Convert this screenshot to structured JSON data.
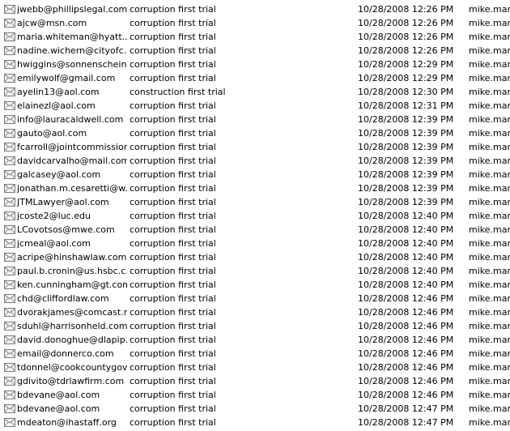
{
  "rows": [
    {
      "from": "jwebb@phillipslegal.com",
      "subject": "corruption first trial",
      "date": "10/28/2008 12:26 PM",
      "user": "mike.mars"
    },
    {
      "from": "ajcw@msn.com",
      "subject": "corruption first trial",
      "date": "10/28/2008 12:26 PM",
      "user": "mike.mars"
    },
    {
      "from": "maria.whiteman@hyatt....",
      "subject": "corruption first trial",
      "date": "10/28/2008 12:26 PM",
      "user": "mike.mars"
    },
    {
      "from": "nadine.wichern@cityofc...",
      "subject": "corruption first trial",
      "date": "10/28/2008 12:26 PM",
      "user": "mike.mars"
    },
    {
      "from": "hwiggins@sonnenschein....",
      "subject": "corruption first trial",
      "date": "10/28/2008 12:29 PM",
      "user": "mike.mars"
    },
    {
      "from": "emilywolf@gmail.com",
      "subject": "corruption first trial",
      "date": "10/28/2008 12:29 PM",
      "user": "mike.mars"
    },
    {
      "from": "ayelin13@aol.com",
      "subject": "construction first trial",
      "date": "10/28/2008 12:30 PM",
      "user": "mike.mars"
    },
    {
      "from": "elainezl@aol.com",
      "subject": "corruption first trial",
      "date": "10/28/2008 12:31 PM",
      "user": "mike.mars"
    },
    {
      "from": "info@lauracaldwell.com",
      "subject": "corruption first trial",
      "date": "10/28/2008 12:39 PM",
      "user": "mike.mars"
    },
    {
      "from": "gauto@aol.com",
      "subject": "corruption first trial",
      "date": "10/28/2008 12:39 PM",
      "user": "mike.mars"
    },
    {
      "from": "fcarroll@jointcommission....",
      "subject": "corruption first trial",
      "date": "10/28/2008 12:39 PM",
      "user": "mike.mars"
    },
    {
      "from": "davidcarvalho@mail.com",
      "subject": "corruption first trial",
      "date": "10/28/2008 12:39 PM",
      "user": "mike.mars"
    },
    {
      "from": "galcasey@aol.com",
      "subject": "corruption first trial",
      "date": "10/28/2008 12:39 PM",
      "user": "mike.mars"
    },
    {
      "from": "jonathan.m.cesaretti@w...",
      "subject": "corruption first trial",
      "date": "10/28/2008 12:39 PM",
      "user": "mike.mars"
    },
    {
      "from": "JTMLawyer@aol.com",
      "subject": "corruption first trial",
      "date": "10/28/2008 12:39 PM",
      "user": "mike.mars"
    },
    {
      "from": "jcoste2@luc.edu",
      "subject": "corruption first trial",
      "date": "10/28/2008 12:40 PM",
      "user": "mike.mars"
    },
    {
      "from": "LCovotsos@mwe.com",
      "subject": "corruption first trial",
      "date": "10/28/2008 12:40 PM",
      "user": "mike.mars"
    },
    {
      "from": "jcmeal@aol.com",
      "subject": "corruption first trial",
      "date": "10/28/2008 12:40 PM",
      "user": "mike.mars"
    },
    {
      "from": "acripe@hinshawlaw.com",
      "subject": "corruption first trial",
      "date": "10/28/2008 12:40 PM",
      "user": "mike.mars"
    },
    {
      "from": "paul.b.cronin@us.hsbc.c...",
      "subject": "corruption first trial",
      "date": "10/28/2008 12:40 PM",
      "user": "mike.mars"
    },
    {
      "from": "ken.cunningham@gt.com",
      "subject": "corruption first trial",
      "date": "10/28/2008 12:40 PM",
      "user": "mike.mars"
    },
    {
      "from": "chd@cliffordlaw.com",
      "subject": "corruption first trial",
      "date": "10/28/2008 12:46 PM",
      "user": "mike.mars"
    },
    {
      "from": "dvorakjames@comcast.net",
      "subject": "corruption first trial",
      "date": "10/28/2008 12:46 PM",
      "user": "mike.mars"
    },
    {
      "from": "sduhl@harrisonheld.com",
      "subject": "corruption first trial",
      "date": "10/28/2008 12:46 PM",
      "user": "mike.mars"
    },
    {
      "from": "david.donoghue@dlapip...",
      "subject": "corruption first trial",
      "date": "10/28/2008 12:46 PM",
      "user": "mike.mars"
    },
    {
      "from": "email@donnerco.com",
      "subject": "corruption first trial",
      "date": "10/28/2008 12:46 PM",
      "user": "mike.mars"
    },
    {
      "from": "tdonnel@cookcountygov....",
      "subject": "corruption first trial",
      "date": "10/28/2008 12:46 PM",
      "user": "mike.mars"
    },
    {
      "from": "gdivito@tdrlawfirm.com",
      "subject": "corruption first trial",
      "date": "10/28/2008 12:46 PM",
      "user": "mike.mars"
    },
    {
      "from": "bdevane@aol.com",
      "subject": "corruption first trial",
      "date": "10/28/2008 12:46 PM",
      "user": "mike.mars"
    },
    {
      "from": "bdevane@aol.com",
      "subject": "corruption first trial",
      "date": "10/28/2008 12:47 PM",
      "user": "mike.mars"
    },
    {
      "from": "mdeaton@ihastaff.org",
      "subject": "corruption first trial",
      "date": "10/28/2008 12:47 PM",
      "user": "mike.mars"
    }
  ],
  "icon": "envelope-icon"
}
